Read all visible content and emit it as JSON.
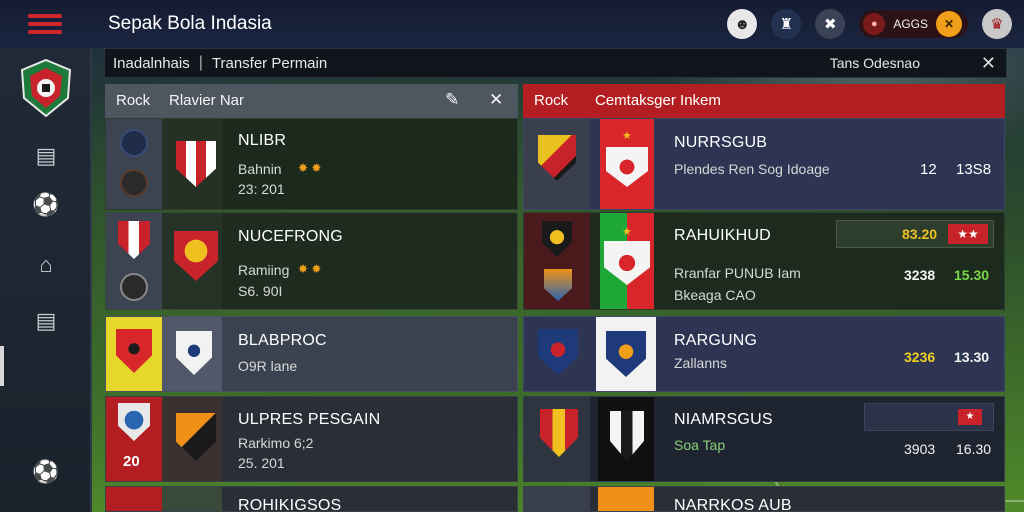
{
  "header": {
    "title": "Sepak Bola Indasia",
    "coin_label": "AGGS"
  },
  "breadcrumb": {
    "item1": "Inadalnhais",
    "item2": "Transfer Permain",
    "right_label": "Tans Odesnao"
  },
  "left_panel": {
    "col1": "Rock",
    "col2": "Rlavier Nar",
    "rows": [
      {
        "name": "NLIBR",
        "sub": "Bahnin",
        "value": "23: 201"
      },
      {
        "name": "NUCEFRONG",
        "sub": "Ramiing",
        "value": "S6. 90I"
      },
      {
        "name": "BLABPROC",
        "sub": "O9R lane",
        "value": ""
      },
      {
        "name": "ULPRES PESGAIN",
        "sub": "Rarkimo 6;2",
        "value": "25. 201",
        "badge": "20"
      },
      {
        "name": "ROHIKIGSOS",
        "sub": "",
        "value": ""
      }
    ]
  },
  "right_panel": {
    "col1": "Rock",
    "col2": "Cemtaksger Inkem",
    "rows": [
      {
        "name": "NURRSGUB",
        "sub": "Plendes Ren Sog Idoage",
        "stat1": "12",
        "stat2": "13S8"
      },
      {
        "name": "RAHUIKHUD",
        "sub": "Rranfar PUNUB Iam",
        "sub2": "Bkeaga CAO",
        "chip": "83.20",
        "stat1": "3238",
        "stat2": "15.30"
      },
      {
        "name": "RARGUNG",
        "sub": "Zallanns",
        "stat1": "3236",
        "stat2": "13.30"
      },
      {
        "name": "NIAMRSGUS",
        "sub": "Soa Tap",
        "stat1": "3903",
        "stat2": "16.30"
      },
      {
        "name": "NARRKOS AUB",
        "sub": ""
      }
    ]
  },
  "icons": {
    "menu": "hamburger-icon",
    "edit": "pencil-icon",
    "close": "close-icon"
  },
  "colors": {
    "accent_red": "#b31e22",
    "row_green": "#1d2c1e",
    "row_blue": "#2d3553"
  }
}
